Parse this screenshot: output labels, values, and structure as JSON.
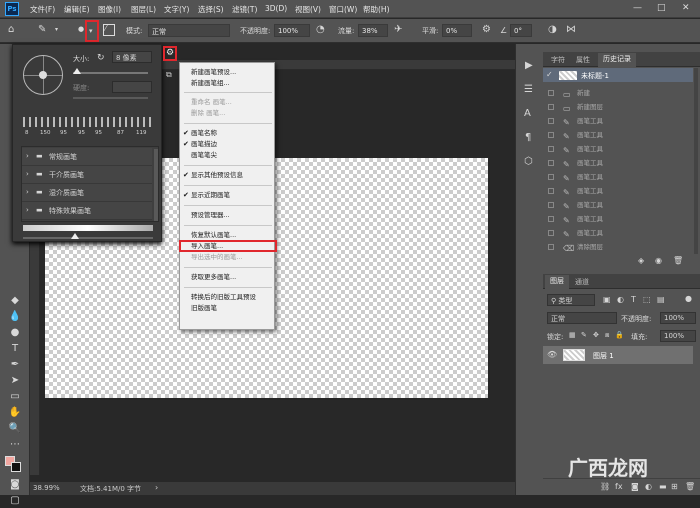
{
  "app": {
    "icon": "Ps"
  },
  "menu": [
    "文件(F)",
    "编辑(E)",
    "图像(I)",
    "图层(L)",
    "文字(Y)",
    "选择(S)",
    "滤镜(T)",
    "3D(D)",
    "视图(V)",
    "窗口(W)",
    "帮助(H)"
  ],
  "window_controls": [
    "—",
    "□",
    "✕"
  ],
  "options": {
    "mode_label": "模式:",
    "mode_value": "正常",
    "opacity_label": "不透明度:",
    "opacity_value": "100%",
    "flow_label": "流量:",
    "flow_value": "38%",
    "smooth_label": "平滑:",
    "smooth_value": "0%",
    "angle_value": "0°"
  },
  "brush_panel": {
    "size_label": "大小:",
    "size_value": "8 像素",
    "hardness_label": "硬度:",
    "presets": [
      "8",
      "150",
      "95",
      "95",
      "95",
      "87",
      "119"
    ],
    "groups": [
      "常规画笔",
      "干介质画笔",
      "湿介质画笔",
      "特殊效果画笔"
    ]
  },
  "dropdown": {
    "items": [
      {
        "label": "新建画笔预设...",
        "dis": false,
        "chk": false
      },
      {
        "label": "新建画笔组...",
        "dis": false,
        "chk": false
      },
      {
        "label": "重命名 画笔...",
        "dis": true,
        "chk": false
      },
      {
        "label": "删除 画笔...",
        "dis": true,
        "chk": false
      },
      {
        "label": "画笔名称",
        "dis": false,
        "chk": true
      },
      {
        "label": "画笔描边",
        "dis": false,
        "chk": true
      },
      {
        "label": "画笔笔尖",
        "dis": false,
        "chk": false
      },
      {
        "label": "显示其他预设信息",
        "dis": false,
        "chk": true
      },
      {
        "label": "显示近期画笔",
        "dis": false,
        "chk": true
      },
      {
        "label": "预设管理器...",
        "dis": false,
        "chk": false
      },
      {
        "label": "恢复默认画笔...",
        "dis": false,
        "chk": false
      },
      {
        "label": "导入画笔...",
        "dis": false,
        "chk": false
      },
      {
        "label": "导出选中的画笔...",
        "dis": true,
        "chk": false
      },
      {
        "label": "获取更多画笔...",
        "dis": false,
        "chk": false
      },
      {
        "label": "转换后的旧版工具预设",
        "dis": false,
        "chk": false
      },
      {
        "label": "旧版画笔",
        "dis": false,
        "chk": false
      }
    ]
  },
  "history": {
    "tabs": [
      "字符",
      "属性",
      "历史记录"
    ],
    "doc": "未标题-1",
    "steps": [
      "新建",
      "新建图层",
      "画笔工具",
      "画笔工具",
      "画笔工具",
      "画笔工具",
      "画笔工具",
      "画笔工具",
      "画笔工具",
      "画笔工具",
      "画笔工具",
      "清除图层"
    ]
  },
  "layers": {
    "tabs": [
      "图层",
      "通道"
    ],
    "kind": "类型",
    "blend": "正常",
    "opacity_label": "不透明度:",
    "opacity_value": "100%",
    "lock_label": "锁定:",
    "fill_label": "填充:",
    "fill_value": "100%",
    "layer_name": "图层 1"
  },
  "status": {
    "zoom": "38.99%",
    "doc": "文档:5.41M/0 字节"
  },
  "watermark": "广西龙网"
}
